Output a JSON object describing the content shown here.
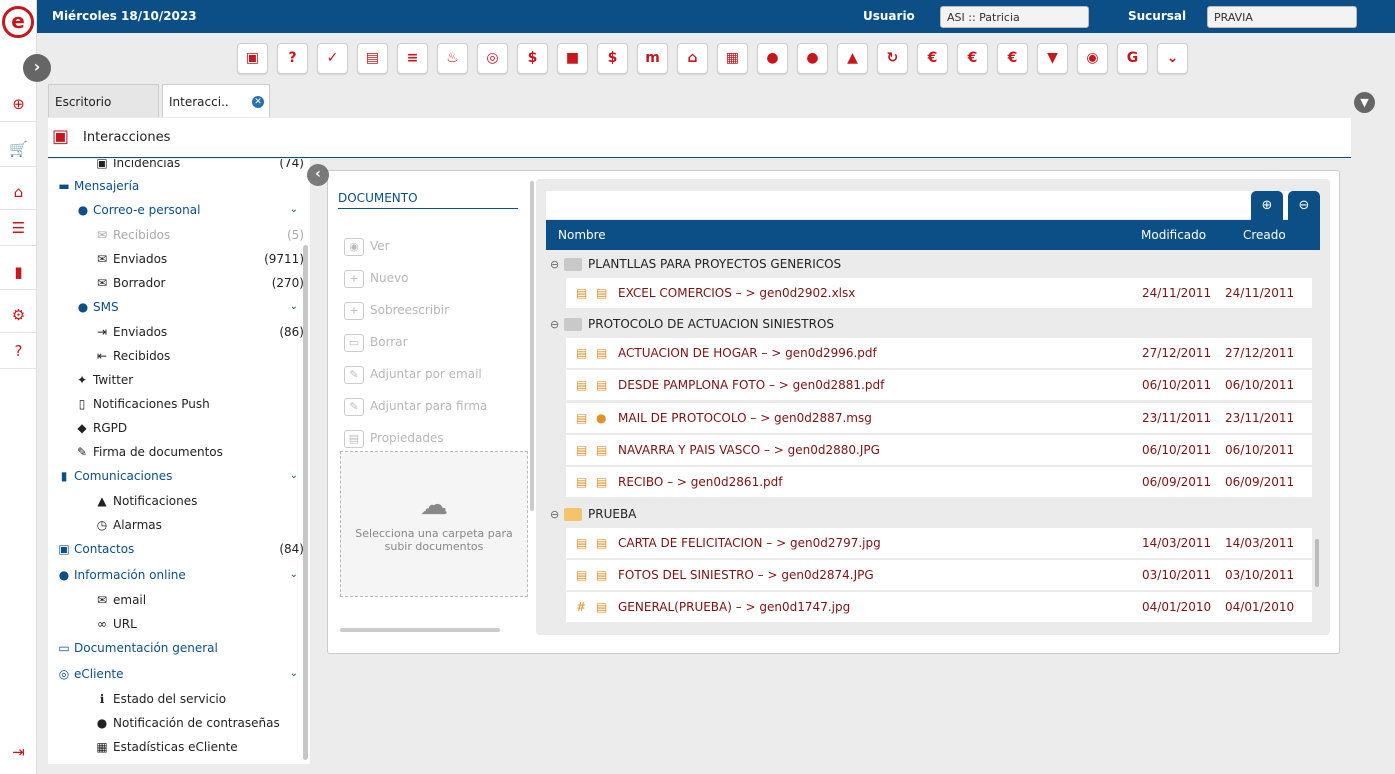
{
  "header": {
    "date": "Miércoles 18/10/2023",
    "user_label": "Usuario",
    "user_value": "ASI :: Patricia",
    "branch_label": "Sucursal",
    "branch_value": "PRAVIA"
  },
  "logo": "e",
  "leftbar": {
    "items": [
      {
        "icon": "plus-circle-icon",
        "glyph": "⊕"
      },
      {
        "icon": "cart-icon",
        "glyph": "🛒"
      },
      {
        "icon": "house-doc-icon",
        "glyph": "⌂"
      },
      {
        "icon": "sliders-icon",
        "glyph": "☰"
      },
      {
        "icon": "bar-chart-icon",
        "glyph": "▮"
      },
      {
        "icon": "gear-icon",
        "glyph": "⚙"
      },
      {
        "icon": "help-icon",
        "glyph": "?"
      }
    ],
    "logout_glyph": "⇥"
  },
  "toolbar": {
    "buttons": [
      {
        "icon": "cube-icon",
        "glyph": "▣"
      },
      {
        "icon": "person-question-icon",
        "glyph": "?"
      },
      {
        "icon": "person-check-icon",
        "glyph": "✓"
      },
      {
        "icon": "document-icon",
        "glyph": "▤"
      },
      {
        "icon": "list-icon",
        "glyph": "≡"
      },
      {
        "icon": "fire-icon",
        "glyph": "♨"
      },
      {
        "icon": "target-icon",
        "glyph": "◎"
      },
      {
        "icon": "money-icon",
        "glyph": "$"
      },
      {
        "icon": "briefcase-icon",
        "glyph": "■"
      },
      {
        "icon": "bag-icon",
        "glyph": "$"
      },
      {
        "icon": "m-logo-icon",
        "glyph": "m"
      },
      {
        "icon": "house-icon",
        "glyph": "⌂"
      },
      {
        "icon": "building-icon",
        "glyph": "▦"
      },
      {
        "icon": "person-icon",
        "glyph": "●"
      },
      {
        "icon": "people-icon",
        "glyph": "●"
      },
      {
        "icon": "buildings-icon",
        "glyph": "▲"
      },
      {
        "icon": "cycle-icon",
        "glyph": "↻"
      },
      {
        "icon": "person-euro-icon",
        "glyph": "€"
      },
      {
        "icon": "euro-icon",
        "glyph": "€"
      },
      {
        "icon": "house-euro-icon",
        "glyph": "€"
      },
      {
        "icon": "shield-down-icon",
        "glyph": "▼"
      },
      {
        "icon": "eye-icon",
        "glyph": "◉"
      },
      {
        "icon": "g-logo-icon",
        "glyph": "G"
      },
      {
        "icon": "chevron-down-icon",
        "glyph": "⌄"
      }
    ]
  },
  "tabs": [
    {
      "label": "Escritorio"
    },
    {
      "label": "Interacci.."
    }
  ],
  "panel_title": "Interacciones",
  "tree": {
    "items": [
      {
        "label": "Incidencias",
        "count": "(74)",
        "kind": "leaf2",
        "icon": "incident-icon",
        "glyph": "▣"
      },
      {
        "label": "Mensajería",
        "count": "",
        "kind": "sect",
        "icon": "chat-icon",
        "glyph": "▬"
      },
      {
        "label": "Correo-e personal",
        "count": "",
        "kind": "sub",
        "icon": "person-mail-icon",
        "glyph": "●",
        "chev": "⌄"
      },
      {
        "label": "Recibidos",
        "count": "(5)",
        "kind": "leaf2dis",
        "icon": "inbox-icon",
        "glyph": "✉"
      },
      {
        "label": "Enviados",
        "count": "(9711)",
        "kind": "leaf2",
        "icon": "sent-icon",
        "glyph": "✉"
      },
      {
        "label": "Borrador",
        "count": "(270)",
        "kind": "leaf2",
        "icon": "draft-icon",
        "glyph": "✉"
      },
      {
        "label": "SMS",
        "count": "",
        "kind": "sub",
        "icon": "sms-icon",
        "glyph": "●",
        "chev": "⌄"
      },
      {
        "label": "Enviados",
        "count": "(86)",
        "kind": "leaf2",
        "icon": "sms-sent-icon",
        "glyph": "⇥"
      },
      {
        "label": "Recibidos",
        "count": "",
        "kind": "leaf2",
        "icon": "sms-received-icon",
        "glyph": "⇤"
      },
      {
        "label": "Twitter",
        "count": "",
        "kind": "leaf1",
        "icon": "twitter-icon",
        "glyph": "✦"
      },
      {
        "label": "Notificaciones Push",
        "count": "",
        "kind": "leaf1",
        "icon": "phone-icon",
        "glyph": "▯"
      },
      {
        "label": "RGPD",
        "count": "",
        "kind": "leaf1",
        "icon": "shield-icon",
        "glyph": "◆"
      },
      {
        "label": "Firma de documentos",
        "count": "",
        "kind": "leaf1",
        "icon": "signature-icon",
        "glyph": "✎"
      },
      {
        "label": "Comunicaciones",
        "count": "",
        "kind": "sect",
        "icon": "signal-icon",
        "glyph": "▮",
        "chev": "⌄"
      },
      {
        "label": "Notificaciones",
        "count": "",
        "kind": "leaf2",
        "icon": "bell-icon",
        "glyph": "▲"
      },
      {
        "label": "Alarmas",
        "count": "",
        "kind": "leaf2",
        "icon": "alarm-icon",
        "glyph": "◷"
      },
      {
        "label": "Contactos",
        "count": "(84)",
        "kind": "sect",
        "icon": "contact-icon",
        "glyph": "▣"
      },
      {
        "label": "Información online",
        "count": "",
        "kind": "sect",
        "icon": "globe-icon",
        "glyph": "●",
        "chev": "⌄"
      },
      {
        "label": "email",
        "count": "",
        "kind": "leaf2",
        "icon": "envelope-icon",
        "glyph": "✉"
      },
      {
        "label": "URL",
        "count": "",
        "kind": "leaf2",
        "icon": "link-icon",
        "glyph": "∞"
      },
      {
        "label": "Documentación general",
        "count": "",
        "kind": "sect",
        "icon": "folder-icon",
        "glyph": "▭"
      },
      {
        "label": "eCliente",
        "count": "",
        "kind": "sect",
        "icon": "ecliente-icon",
        "glyph": "◎",
        "chev": "⌄"
      },
      {
        "label": "Estado del servicio",
        "count": "",
        "kind": "leaf2",
        "icon": "info-icon",
        "glyph": "ℹ"
      },
      {
        "label": "Notificación de contraseñas",
        "count": "",
        "kind": "leaf2",
        "icon": "key-person-icon",
        "glyph": "●"
      },
      {
        "label": "Estadísticas eCliente",
        "count": "",
        "kind": "leaf2",
        "icon": "stats-icon",
        "glyph": "▦"
      }
    ]
  },
  "document": {
    "header": "DOCUMENTO",
    "actions": [
      {
        "label": "Ver",
        "icon": "view-icon",
        "glyph": "◉"
      },
      {
        "label": "Nuevo",
        "icon": "new-icon",
        "glyph": "+"
      },
      {
        "label": "Sobreescribir",
        "icon": "overwrite-icon",
        "glyph": "+"
      },
      {
        "label": "Borrar",
        "icon": "delete-icon",
        "glyph": "▭"
      },
      {
        "label": "Adjuntar por email",
        "icon": "attach-email-icon",
        "glyph": "✎"
      },
      {
        "label": "Adjuntar para firma",
        "icon": "attach-sign-icon",
        "glyph": "✎"
      },
      {
        "label": "Propiedades",
        "icon": "properties-icon",
        "glyph": "▤"
      }
    ],
    "dropzone_message": "Selecciona una carpeta para subir documentos"
  },
  "grid": {
    "columns": {
      "name": "Nombre",
      "modified": "Modificado",
      "created": "Creado"
    },
    "expand_glyph": "⊕",
    "collapse_glyph": "⊖",
    "groups": [
      {
        "name": "PLANTLLAS PARA PROYECTOS GENERICOS",
        "open": false,
        "files": [
          {
            "name": "EXCEL COMERCIOS – > gen0d2902.xlsx",
            "modified": "24/11/2011",
            "created": "24/11/2011",
            "lead": "▤",
            "type_glyph": "▤"
          }
        ]
      },
      {
        "name": "PROTOCOLO DE ACTUACION SINIESTROS",
        "open": false,
        "files": [
          {
            "name": "ACTUACION DE HOGAR – > gen0d2996.pdf",
            "modified": "27/12/2011",
            "created": "27/12/2011",
            "lead": "▤",
            "type_glyph": "▤"
          },
          {
            "name": "DESDE PAMPLONA FOTO – > gen0d2881.pdf",
            "modified": "06/10/2011",
            "created": "06/10/2011",
            "lead": "▤",
            "type_glyph": "▤"
          },
          {
            "name": "MAIL DE PROTOCOLO – > gen0d2887.msg",
            "modified": "23/11/2011",
            "created": "23/11/2011",
            "lead": "▤",
            "type_glyph": "●"
          },
          {
            "name": "NAVARRA Y PAIS VASCO – > gen0d2880.JPG",
            "modified": "06/10/2011",
            "created": "06/10/2011",
            "lead": "▤",
            "type_glyph": "▤"
          },
          {
            "name": "RECIBO – > gen0d2861.pdf",
            "modified": "06/09/2011",
            "created": "06/09/2011",
            "lead": "▤",
            "type_glyph": "▤"
          }
        ]
      },
      {
        "name": "PRUEBA",
        "open": true,
        "files": [
          {
            "name": "CARTA DE FELICITACION – > gen0d2797.jpg",
            "modified": "14/03/2011",
            "created": "14/03/2011",
            "lead": "▤",
            "type_glyph": "▤"
          },
          {
            "name": "FOTOS DEL SINIESTRO – > gen0d2874.JPG",
            "modified": "03/10/2011",
            "created": "03/10/2011",
            "lead": "▤",
            "type_glyph": "▤"
          },
          {
            "name": "GENERAL(PRUEBA) – > gen0d1747.jpg",
            "modified": "04/01/2010",
            "created": "04/01/2010",
            "lead": "#",
            "type_glyph": "▤"
          }
        ]
      }
    ]
  },
  "colors": {
    "brand_blue": "#0b4f86",
    "brand_red": "#c8161d",
    "file_orange": "#e0922a",
    "file_text": "#7a1313"
  }
}
